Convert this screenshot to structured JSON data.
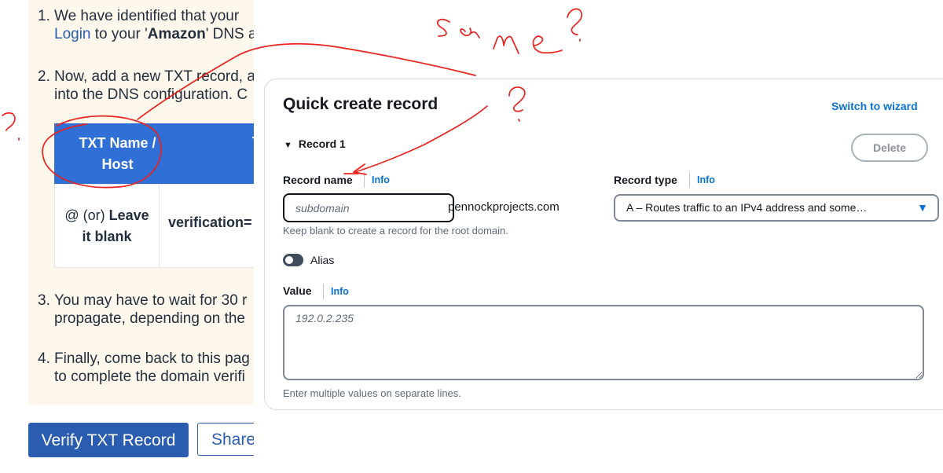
{
  "left": {
    "step1": {
      "num": "1.",
      "line1": "We have identified that your ",
      "link": "Login",
      "line2_mid": " to your '",
      "provider": "Amazon",
      "line2_end": "' DNS a"
    },
    "step2": {
      "num": "2.",
      "line1": "Now, add a new TXT record, a",
      "line2": "into the DNS configuration. C"
    },
    "table": {
      "header1": "TXT Name / Host",
      "header2": "T",
      "cell1_pre": "@ (or) ",
      "cell1_bold": "Leave it blank",
      "cell2": "verification="
    },
    "step3": {
      "num": "3.",
      "line1": "You may have to wait for 30 r",
      "line2": "propagate, depending on the"
    },
    "step4": {
      "num": "4.",
      "line1": "Finally, come back to this pag",
      "line2": "to complete the domain verifi"
    },
    "verify_button": "Verify TXT Record",
    "share_button": "Share"
  },
  "modal": {
    "title": "Quick create record",
    "switch_wizard": "Switch to wizard",
    "record_toggle": "Record 1",
    "delete_button": "Delete",
    "record_name": {
      "label": "Record name",
      "info": "Info",
      "placeholder": "subdomain",
      "domain_suffix": "pennockprojects.com",
      "hint": "Keep blank to create a record for the root domain."
    },
    "record_type": {
      "label": "Record type",
      "info": "Info",
      "selected": "A – Routes traffic to an IPv4 address and some…"
    },
    "alias": {
      "label": "Alias",
      "enabled": false
    },
    "value": {
      "label": "Value",
      "info": "Info",
      "placeholder": "192.0.2.235",
      "hint": "Enter multiple values on separate lines."
    }
  },
  "annotation_colors": {
    "ink": "#e8231e"
  }
}
